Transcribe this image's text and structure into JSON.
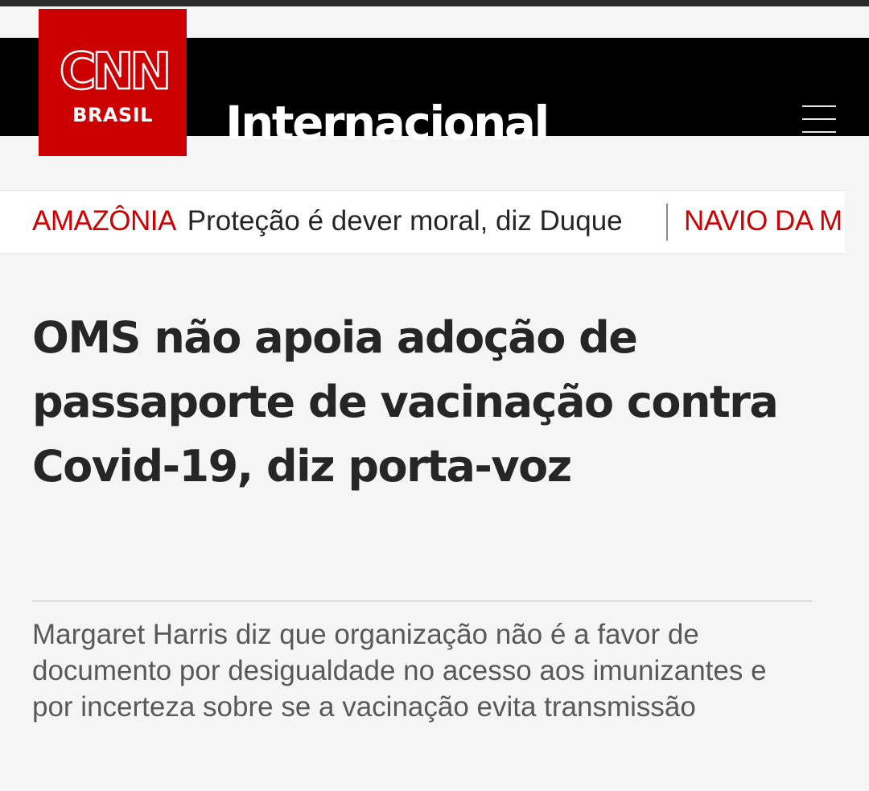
{
  "header": {
    "logo": {
      "mark": "CNN",
      "subtitle": "BRASIL",
      "color": "#cc0000"
    },
    "section_title": "Internacional",
    "menu_icon": "hamburger-menu-icon"
  },
  "ticker": {
    "items": [
      {
        "tag": "AMAZÔNIA",
        "text": "Proteção é dever moral, diz Duque"
      },
      {
        "tag": "NAVIO DA M",
        "text": ""
      }
    ],
    "tag_color": "#cc0000"
  },
  "article": {
    "headline": "OMS não apoia adoção de passaporte de vacinação contra Covid-19, diz porta-voz",
    "summary": "Margaret Harris diz que organização não é a favor de documento por desigualdade no acesso aos imunizantes e por incerteza sobre se a vacinação evita transmissão"
  }
}
